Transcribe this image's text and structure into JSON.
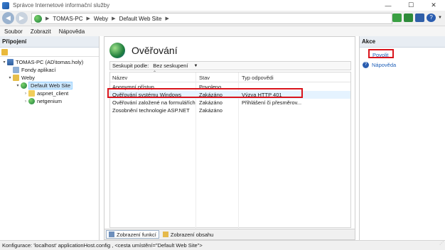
{
  "window": {
    "title": "Správce Internetové informační služby"
  },
  "address": {
    "crumbs": [
      "TOMAS-PC",
      "Weby",
      "Default Web Site"
    ]
  },
  "menu": [
    "Soubor",
    "Zobrazit",
    "Nápověda"
  ],
  "left": {
    "header": "Připojení",
    "tree": [
      {
        "label": "TOMAS-PC (AD\\tomas.holy)",
        "expander": "▾",
        "icon": "server-icon"
      },
      {
        "label": "Fondy aplikací",
        "expander": "",
        "icon": "app-pool-icon"
      },
      {
        "label": "Weby",
        "expander": "▾",
        "icon": "sites-icon"
      },
      {
        "label": "Default Web Site",
        "expander": "▾",
        "icon": "globe-icon"
      },
      {
        "label": "aspnet_client",
        "expander": "›",
        "icon": "folder-icon"
      },
      {
        "label": "netgenium",
        "expander": "›",
        "icon": "globe-icon"
      }
    ]
  },
  "center": {
    "title": "Ověřování",
    "group_label": "Seskupit podle:",
    "group_value": "Bez seskupení",
    "columns": [
      "Název",
      "Stav",
      "Typ odpovědi"
    ],
    "rows": [
      {
        "name": "Anonymní přístup",
        "state": "Povoleno",
        "type": ""
      },
      {
        "name": "Ověřování systému Windows",
        "state": "Zakázáno",
        "type": "Výzva HTTP 401"
      },
      {
        "name": "Ověřování založené na formulářích",
        "state": "Zakázáno",
        "type": "Přihlášení či přesměrov..."
      },
      {
        "name": "Zosobnění technologie ASP.NET",
        "state": "Zakázáno",
        "type": ""
      }
    ],
    "tabs": [
      "Zobrazení funkcí",
      "Zobrazení obsahu"
    ]
  },
  "right": {
    "header": "Akce",
    "actions": [
      "Povolit",
      "Nápověda"
    ]
  },
  "status": {
    "text": "Konfigurace: 'localhost' applicationHost.config , <cesta umístění=\"Default Web Site\">"
  },
  "colors": {
    "highlight": "#d9141c",
    "link": "#1f5fb8",
    "selection": "#e5f3ff"
  }
}
